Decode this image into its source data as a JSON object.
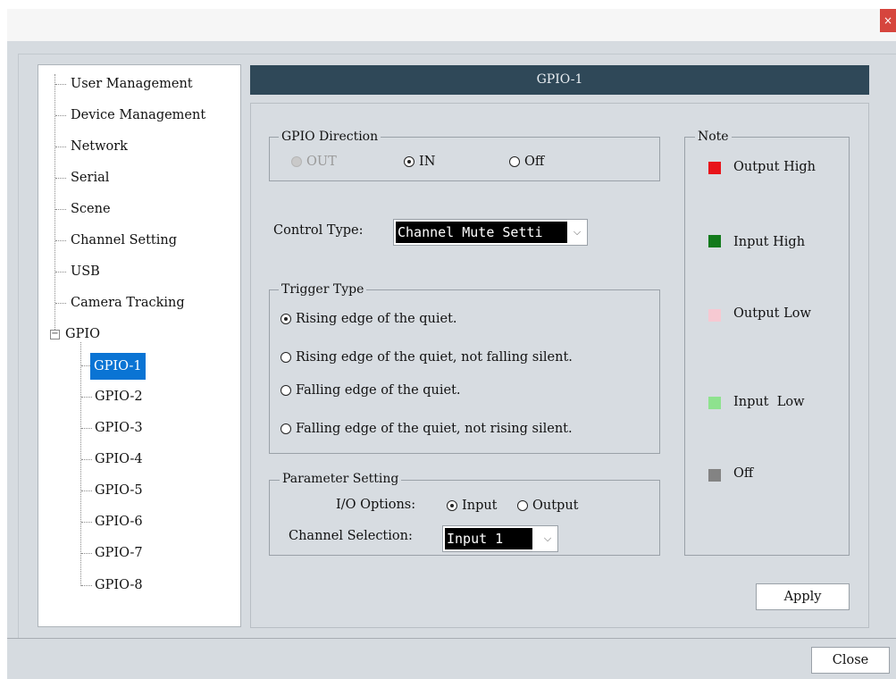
{
  "window": {
    "close_glyph": "×"
  },
  "tree": {
    "items": [
      {
        "label": "User Management"
      },
      {
        "label": "Device Management"
      },
      {
        "label": "Network"
      },
      {
        "label": "Serial"
      },
      {
        "label": "Scene"
      },
      {
        "label": "Channel Setting"
      },
      {
        "label": "USB"
      },
      {
        "label": "Camera Tracking"
      },
      {
        "label": "GPIO"
      }
    ],
    "gpio_expander": "−",
    "children": [
      {
        "label": "GPIO-1"
      },
      {
        "label": "GPIO-2"
      },
      {
        "label": "GPIO-3"
      },
      {
        "label": "GPIO-4"
      },
      {
        "label": "GPIO-5"
      },
      {
        "label": "GPIO-6"
      },
      {
        "label": "GPIO-7"
      },
      {
        "label": "GPIO-8"
      }
    ],
    "selected": "GPIO-1"
  },
  "header": {
    "title": "GPIO-1"
  },
  "direction": {
    "title": "GPIO Direction",
    "options": [
      {
        "label": "OUT",
        "state": "disabled"
      },
      {
        "label": "IN",
        "state": "checked"
      },
      {
        "label": "Off",
        "state": "unchecked"
      }
    ]
  },
  "control_type": {
    "label": "Control Type:",
    "value": "Channel Mute Setti"
  },
  "trigger": {
    "title": "Trigger Type",
    "options": [
      {
        "label": "Rising edge of the quiet.",
        "checked": true
      },
      {
        "label": "Rising edge of the quiet, not falling silent.",
        "checked": false
      },
      {
        "label": "Falling edge of the quiet.",
        "checked": false
      },
      {
        "label": "Falling edge of the quiet, not rising silent.",
        "checked": false
      }
    ]
  },
  "parameter": {
    "title": "Parameter Setting",
    "io_label": "I/O Options:",
    "io_options": [
      {
        "label": "Input",
        "checked": true
      },
      {
        "label": "Output",
        "checked": false
      }
    ],
    "channel_label": "Channel Selection:",
    "channel_value": "Input 1"
  },
  "note": {
    "title": "Note",
    "items": [
      {
        "label": "Output High",
        "color": "#e8141a"
      },
      {
        "label": "Input High",
        "color": "#137a1c"
      },
      {
        "label": "Output Low",
        "color": "#f6c9d2"
      },
      {
        "label": "Input  Low",
        "color": "#8ee28e"
      },
      {
        "label": "Off",
        "color": "#838383"
      }
    ]
  },
  "buttons": {
    "apply": "Apply",
    "close": "Close"
  },
  "icons": {
    "dropdown": "chevron-down-icon",
    "expander": "minus-box-icon",
    "window_close": "close-icon"
  },
  "arrow_glyph": "⌵"
}
